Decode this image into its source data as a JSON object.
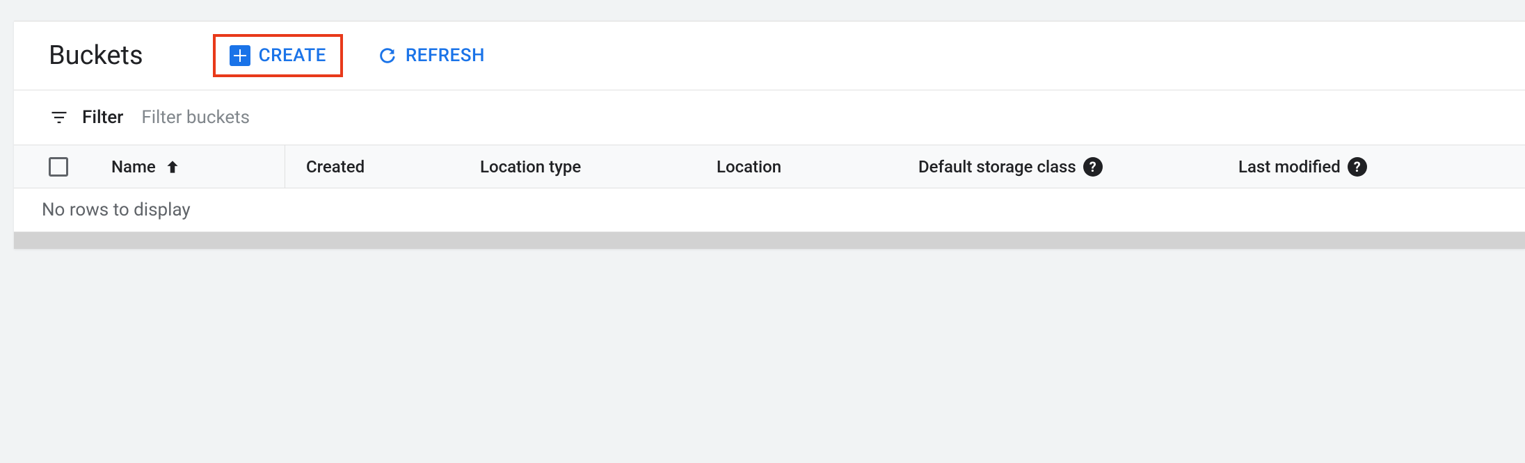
{
  "header": {
    "title": "Buckets",
    "create_label": "CREATE",
    "refresh_label": "REFRESH"
  },
  "filter": {
    "label": "Filter",
    "placeholder": "Filter buckets"
  },
  "table": {
    "columns": {
      "name": "Name",
      "created": "Created",
      "location_type": "Location type",
      "location": "Location",
      "default_storage_class": "Default storage class",
      "last_modified": "Last modified"
    },
    "sort_column": "name",
    "sort_direction": "asc",
    "empty_message": "No rows to display",
    "rows": []
  },
  "colors": {
    "primary": "#1a73e8",
    "highlight_border": "#e8391a",
    "text": "#202124",
    "muted": "#5f6368"
  }
}
